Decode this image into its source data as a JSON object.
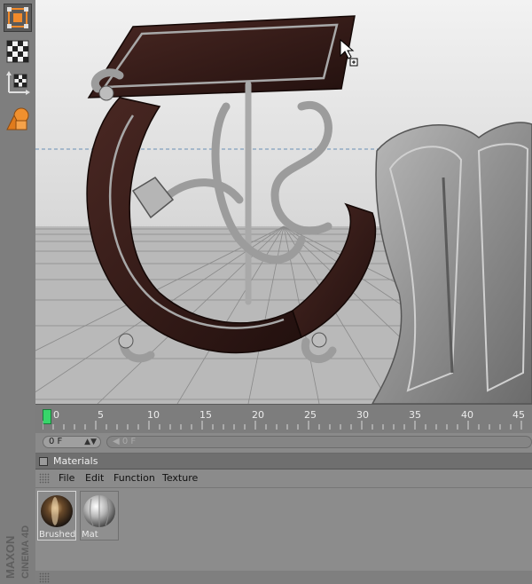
{
  "timeline": {
    "ticks": [
      "0",
      "5",
      "10",
      "15",
      "20",
      "25",
      "30",
      "35",
      "40",
      "45"
    ],
    "current_frame": "0 F",
    "end_frame_hint": "0 F"
  },
  "materials": {
    "title": "Materials",
    "menu": [
      "File",
      "Edit",
      "Function",
      "Texture"
    ],
    "items": [
      {
        "label": "Brushed",
        "selected": true
      },
      {
        "label": "Mat",
        "selected": false
      }
    ]
  },
  "brand": {
    "line1": "MAXON",
    "line2": "CINEMA 4D"
  },
  "colors": {
    "viewport_bg": "#c9c9c9",
    "playhead": "#37d66a",
    "letter_dark": "#3a1f1c",
    "letter_metal": "#9b9b9b"
  },
  "icons": [
    "select-icon",
    "checker-icon",
    "axis-checker-icon",
    "primitive-shapes-icon",
    "cursor-icon"
  ]
}
